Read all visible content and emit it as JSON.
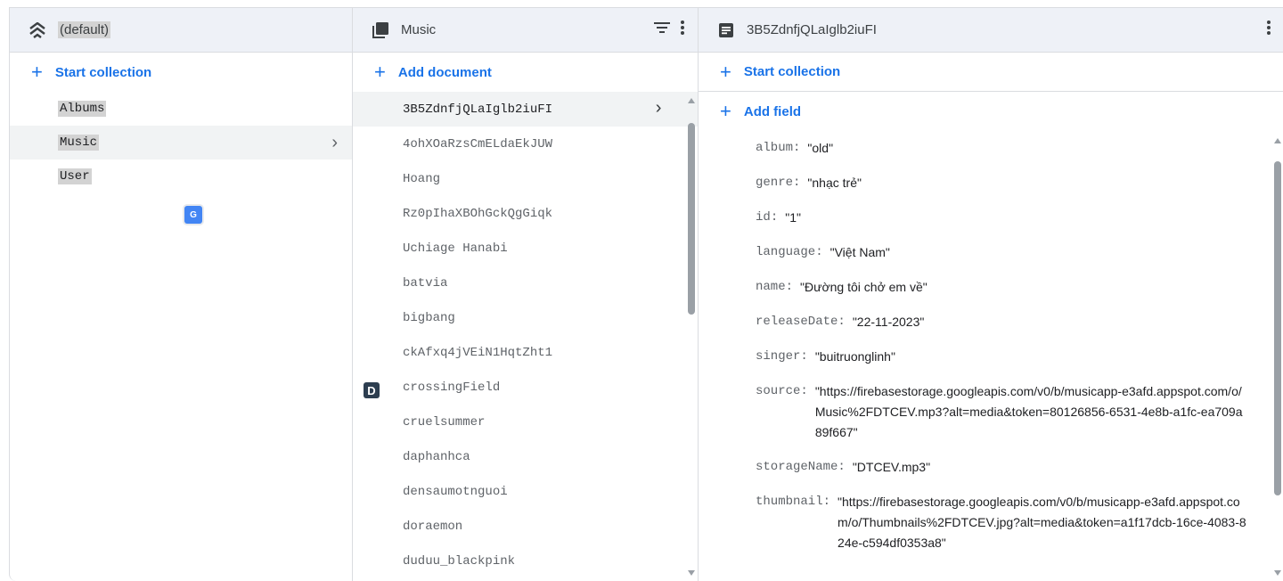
{
  "root_panel": {
    "title": "(default)",
    "start_collection_label": "Start collection",
    "collections": [
      "Albums",
      "Music",
      "User"
    ],
    "selected_index": 1
  },
  "collection_panel": {
    "title": "Music",
    "add_document_label": "Add document",
    "documents": [
      "3B5ZdnfjQLaIglb2iuFI",
      "4ohXOaRzsCmELdaEkJUW",
      "Hoang",
      "Rz0pIhaXBOhGckQgGiqk",
      "Uchiage Hanabi",
      "batvia",
      "bigbang",
      "ckAfxq4jVEiN1HqtZht1",
      "crossingField",
      "cruelsummer",
      "daphanhca",
      "densaumotnguoi",
      "doraemon",
      "duduu_blackpink"
    ],
    "selected_index": 0
  },
  "document_panel": {
    "title": "3B5ZdnfjQLaIglb2iuFI",
    "start_collection_label": "Start collection",
    "add_field_label": "Add field",
    "fields": [
      {
        "key": "album",
        "value": "\"old\""
      },
      {
        "key": "genre",
        "value": "\"nhạc trẻ\""
      },
      {
        "key": "id",
        "value": "\"1\""
      },
      {
        "key": "language",
        "value": "\"Việt Nam\""
      },
      {
        "key": "name",
        "value": "\"Đường tôi chở em về\""
      },
      {
        "key": "releaseDate",
        "value": "\"22-11-2023\""
      },
      {
        "key": "singer",
        "value": "\"buitruonglinh\""
      },
      {
        "key": "source",
        "value": "\"https://firebasestorage.googleapis.com/v0/b/musicapp-e3afd.appspot.com/o/Music%2FDTCEV.mp3?alt=media&token=80126856-6531-4e8b-a1fc-ea709a89f667\""
      },
      {
        "key": "storageName",
        "value": "\"DTCEV.mp3\""
      },
      {
        "key": "thumbnail",
        "value": "\"https://firebasestorage.googleapis.com/v0/b/musicapp-e3afd.appspot.com/o/Thumbnails%2FDTCEV.jpg?alt=media&token=a1f17dcb-16ce-4083-824e-c594df0353a8\""
      }
    ]
  },
  "overlay": {
    "translate_badge": "G",
    "extension_badge": "D"
  },
  "colors": {
    "accent": "#1a73e8",
    "header_bg": "#eef1f7",
    "selected_bg": "#f1f3f4"
  }
}
